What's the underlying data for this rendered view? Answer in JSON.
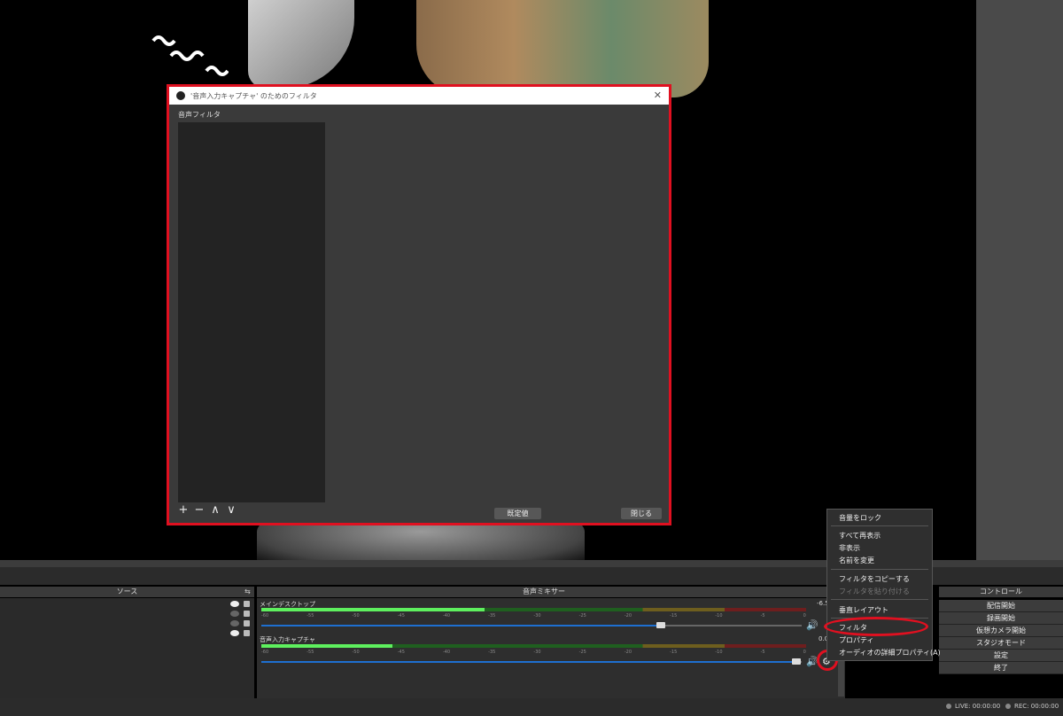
{
  "dialog": {
    "title": "'音声入力キャプチャ' のためのフィルタ",
    "close_glyph": "✕",
    "section_label": "音声フィルタ",
    "tools": {
      "add": "+",
      "remove": "−",
      "up": "∧",
      "down": "∨"
    },
    "default_button": "既定値",
    "close_button": "閉じる"
  },
  "sources": {
    "header": "ソース",
    "settings_glyph": "⇆",
    "items": [
      {
        "visible": true
      },
      {
        "visible": false
      },
      {
        "visible": false
      },
      {
        "visible": true
      }
    ]
  },
  "mixer": {
    "header": "音声ミキサー",
    "tick_labels": [
      "-60",
      "-55",
      "-50",
      "-45",
      "-40",
      "-35",
      "-30",
      "-25",
      "-20",
      "-15",
      "-10",
      "-5",
      "0"
    ],
    "tracks": [
      {
        "name": "メインデスクトップ",
        "db": "-6.5",
        "meter_level": 0.41,
        "volume": 0.74
      },
      {
        "name": "音声入力キャプチャ",
        "db": "0.0",
        "meter_level": 0.24,
        "volume": 0.99
      }
    ],
    "speaker_glyph": "🔊",
    "gear_glyph": "⚙"
  },
  "controls": {
    "header": "コントロール",
    "buttons": [
      "配信開始",
      "録画開始",
      "仮想カメラ開始",
      "スタジオモード",
      "設定",
      "終了"
    ]
  },
  "status": {
    "live": "LIVE: 00:00:00",
    "rec": "REC: 00:00:00"
  },
  "context_menu": {
    "items": [
      {
        "label": "音量をロック",
        "disabled": false
      },
      {
        "label": "すべて再表示",
        "disabled": false
      },
      {
        "label": "非表示",
        "disabled": false
      },
      {
        "label": "名前を変更",
        "disabled": false
      },
      {
        "label": "フィルタをコピーする",
        "disabled": false
      },
      {
        "label": "フィルタを貼り付ける",
        "disabled": true
      },
      {
        "label": "垂直レイアウト",
        "disabled": false
      },
      {
        "label": "フィルタ",
        "disabled": false,
        "highlighted": true
      },
      {
        "label": "プロパティ",
        "disabled": false
      },
      {
        "label": "オーディオの詳細プロパティ(A)",
        "disabled": false
      }
    ]
  },
  "colors": {
    "highlight_red": "#e01020",
    "accent_blue": "#1f6fd0",
    "meter_green": "#5ef05e"
  }
}
